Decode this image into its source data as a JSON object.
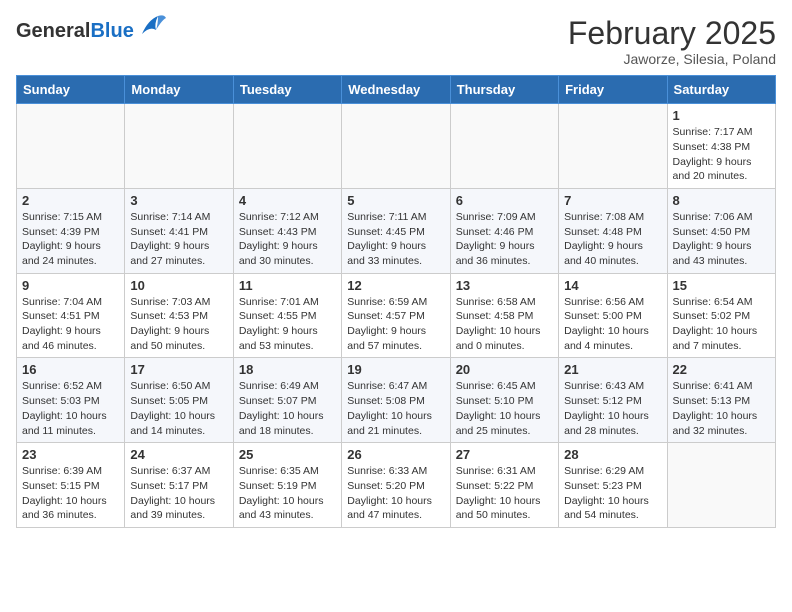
{
  "header": {
    "logo_line1": "General",
    "logo_line2": "Blue",
    "title": "February 2025",
    "subtitle": "Jaworze, Silesia, Poland"
  },
  "weekdays": [
    "Sunday",
    "Monday",
    "Tuesday",
    "Wednesday",
    "Thursday",
    "Friday",
    "Saturday"
  ],
  "weeks": [
    [
      {
        "day": "",
        "info": ""
      },
      {
        "day": "",
        "info": ""
      },
      {
        "day": "",
        "info": ""
      },
      {
        "day": "",
        "info": ""
      },
      {
        "day": "",
        "info": ""
      },
      {
        "day": "",
        "info": ""
      },
      {
        "day": "1",
        "info": "Sunrise: 7:17 AM\nSunset: 4:38 PM\nDaylight: 9 hours and 20 minutes."
      }
    ],
    [
      {
        "day": "2",
        "info": "Sunrise: 7:15 AM\nSunset: 4:39 PM\nDaylight: 9 hours and 24 minutes."
      },
      {
        "day": "3",
        "info": "Sunrise: 7:14 AM\nSunset: 4:41 PM\nDaylight: 9 hours and 27 minutes."
      },
      {
        "day": "4",
        "info": "Sunrise: 7:12 AM\nSunset: 4:43 PM\nDaylight: 9 hours and 30 minutes."
      },
      {
        "day": "5",
        "info": "Sunrise: 7:11 AM\nSunset: 4:45 PM\nDaylight: 9 hours and 33 minutes."
      },
      {
        "day": "6",
        "info": "Sunrise: 7:09 AM\nSunset: 4:46 PM\nDaylight: 9 hours and 36 minutes."
      },
      {
        "day": "7",
        "info": "Sunrise: 7:08 AM\nSunset: 4:48 PM\nDaylight: 9 hours and 40 minutes."
      },
      {
        "day": "8",
        "info": "Sunrise: 7:06 AM\nSunset: 4:50 PM\nDaylight: 9 hours and 43 minutes."
      }
    ],
    [
      {
        "day": "9",
        "info": "Sunrise: 7:04 AM\nSunset: 4:51 PM\nDaylight: 9 hours and 46 minutes."
      },
      {
        "day": "10",
        "info": "Sunrise: 7:03 AM\nSunset: 4:53 PM\nDaylight: 9 hours and 50 minutes."
      },
      {
        "day": "11",
        "info": "Sunrise: 7:01 AM\nSunset: 4:55 PM\nDaylight: 9 hours and 53 minutes."
      },
      {
        "day": "12",
        "info": "Sunrise: 6:59 AM\nSunset: 4:57 PM\nDaylight: 9 hours and 57 minutes."
      },
      {
        "day": "13",
        "info": "Sunrise: 6:58 AM\nSunset: 4:58 PM\nDaylight: 10 hours and 0 minutes."
      },
      {
        "day": "14",
        "info": "Sunrise: 6:56 AM\nSunset: 5:00 PM\nDaylight: 10 hours and 4 minutes."
      },
      {
        "day": "15",
        "info": "Sunrise: 6:54 AM\nSunset: 5:02 PM\nDaylight: 10 hours and 7 minutes."
      }
    ],
    [
      {
        "day": "16",
        "info": "Sunrise: 6:52 AM\nSunset: 5:03 PM\nDaylight: 10 hours and 11 minutes."
      },
      {
        "day": "17",
        "info": "Sunrise: 6:50 AM\nSunset: 5:05 PM\nDaylight: 10 hours and 14 minutes."
      },
      {
        "day": "18",
        "info": "Sunrise: 6:49 AM\nSunset: 5:07 PM\nDaylight: 10 hours and 18 minutes."
      },
      {
        "day": "19",
        "info": "Sunrise: 6:47 AM\nSunset: 5:08 PM\nDaylight: 10 hours and 21 minutes."
      },
      {
        "day": "20",
        "info": "Sunrise: 6:45 AM\nSunset: 5:10 PM\nDaylight: 10 hours and 25 minutes."
      },
      {
        "day": "21",
        "info": "Sunrise: 6:43 AM\nSunset: 5:12 PM\nDaylight: 10 hours and 28 minutes."
      },
      {
        "day": "22",
        "info": "Sunrise: 6:41 AM\nSunset: 5:13 PM\nDaylight: 10 hours and 32 minutes."
      }
    ],
    [
      {
        "day": "23",
        "info": "Sunrise: 6:39 AM\nSunset: 5:15 PM\nDaylight: 10 hours and 36 minutes."
      },
      {
        "day": "24",
        "info": "Sunrise: 6:37 AM\nSunset: 5:17 PM\nDaylight: 10 hours and 39 minutes."
      },
      {
        "day": "25",
        "info": "Sunrise: 6:35 AM\nSunset: 5:19 PM\nDaylight: 10 hours and 43 minutes."
      },
      {
        "day": "26",
        "info": "Sunrise: 6:33 AM\nSunset: 5:20 PM\nDaylight: 10 hours and 47 minutes."
      },
      {
        "day": "27",
        "info": "Sunrise: 6:31 AM\nSunset: 5:22 PM\nDaylight: 10 hours and 50 minutes."
      },
      {
        "day": "28",
        "info": "Sunrise: 6:29 AM\nSunset: 5:23 PM\nDaylight: 10 hours and 54 minutes."
      },
      {
        "day": "",
        "info": ""
      }
    ]
  ]
}
